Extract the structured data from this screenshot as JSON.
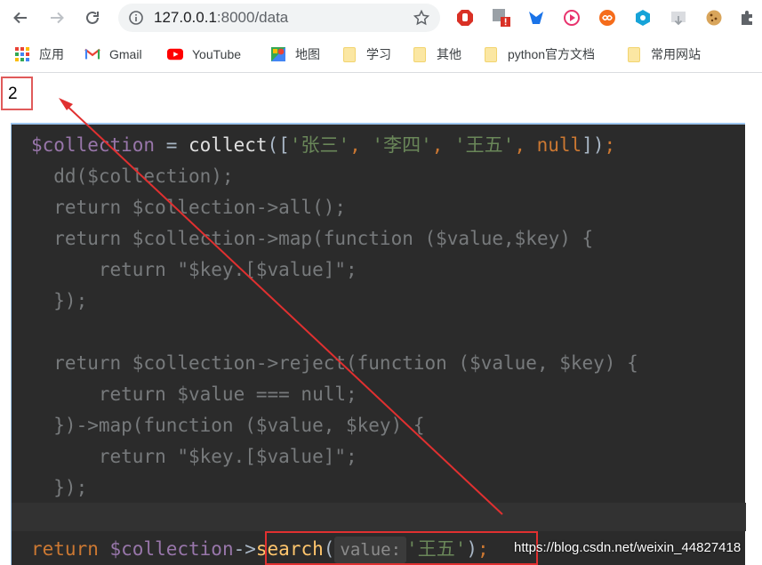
{
  "browser": {
    "url_host": "127.0.0.1",
    "url_rest": ":8000/data"
  },
  "bookmarks": [
    {
      "label": "应用",
      "icon": "apps-grid-icon"
    },
    {
      "label": "Gmail",
      "icon": "gmail-icon"
    },
    {
      "label": "YouTube",
      "icon": "youtube-icon"
    },
    {
      "label": "地图",
      "icon": "maps-icon"
    },
    {
      "label": "学习",
      "icon": "folder-icon"
    },
    {
      "label": "其他",
      "icon": "folder-icon"
    },
    {
      "label": "python官方文档",
      "icon": "folder-icon"
    },
    {
      "label": "常用网站",
      "icon": "folder-icon"
    }
  ],
  "page": {
    "result": "2"
  },
  "code": {
    "line1_var": "$collection",
    "line1_eq": " = ",
    "line1_fn": "collect",
    "line1_open": "([",
    "line1_s1": "'张三'",
    "line1_c1": ", ",
    "line1_s2": "'李四'",
    "line1_c2": ", ",
    "line1_s3": "'王五'",
    "line1_c3": ", ",
    "line1_null": "null",
    "line1_close": "])",
    "line1_semi": ";",
    "line2": "  dd($collection);",
    "line3": "  return $collection->all();",
    "line4": "  return $collection->map(function ($value,$key) {",
    "line5": "      return \"$key.[$value]\";",
    "line6": "  });",
    "line7": "  return $collection->reject(function ($value, $key) {",
    "line8": "      return $value === null;",
    "line9": "  })->map(function ($value, $key) {",
    "line10": "      return \"$key.[$value]\";",
    "line11": "  });",
    "last_return": "return",
    "last_var": "$collection",
    "last_arrow": "->",
    "last_method": "search",
    "last_open": "(",
    "last_hint": "value:",
    "last_arg": "'王五'",
    "last_close": ")",
    "last_semi": ";"
  },
  "watermark": "https://blog.csdn.net/weixin_44827418",
  "colors": {
    "annotation_red": "#e03030",
    "editor_bg": "#2b2b2b"
  }
}
